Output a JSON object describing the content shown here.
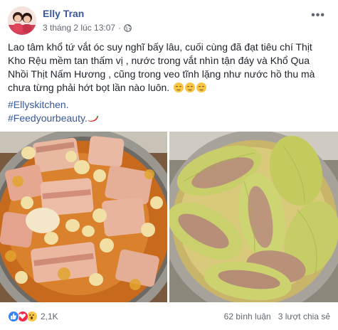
{
  "post": {
    "author": "Elly Tran",
    "timestamp": "3 tháng 2 lúc 13:07",
    "separator": "·",
    "privacy_icon": "globe-icon",
    "more_icon": "ellipsis-icon",
    "body": "Lao tâm khổ tứ vắt óc suy nghĩ bấy lâu, cuối cùng đã đạt tiêu chí Thịt Kho Rệu mềm tan thấm vị , nước trong vắt nhìn tận đáy và Khổ Qua Nhồi Thịt Nấm Hương , cũng trong veo tĩnh lặng như nước hồ thu mà chưa từng phải hớt bọt lần nào luôn.",
    "hashtags": [
      "#Ellyskitchen.",
      "#Feedyourbeauty."
    ],
    "photos": [
      {
        "subject": "pot of braised pork belly with eggs"
      },
      {
        "subject": "pot of stuffed bitter melon soup"
      }
    ]
  },
  "reactions": {
    "icons": [
      "like-icon",
      "love-icon",
      "wow-icon"
    ],
    "count": "2,1K"
  },
  "stats": {
    "comments": "62 bình luận",
    "shares": "3 lượt chia sẻ"
  },
  "colors": {
    "link": "#385898",
    "text": "#1d2129",
    "meta": "#616770",
    "like": "#3b82f6",
    "love": "#f0284a",
    "wow": "#f7c443"
  }
}
